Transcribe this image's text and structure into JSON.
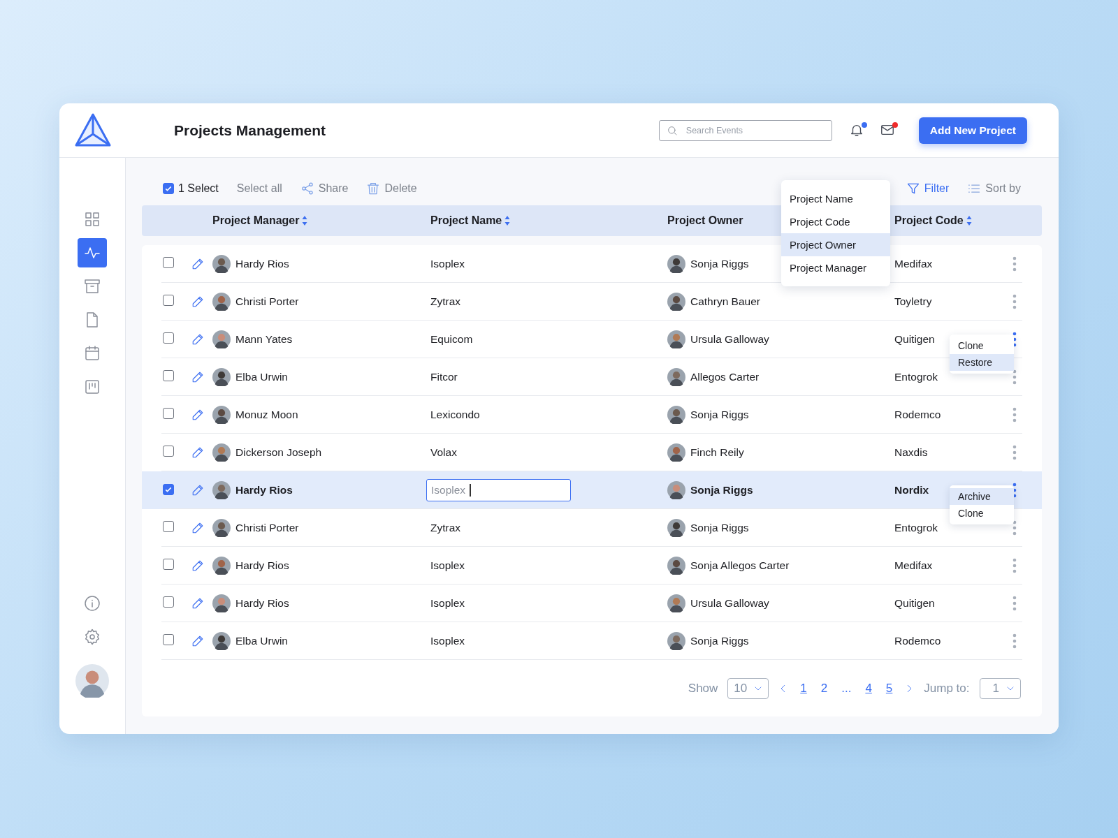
{
  "header": {
    "title": "Projects Management",
    "search": {
      "placeholder": "Search Events"
    },
    "notifications": {
      "unread": true
    },
    "mail": {
      "unread": true
    },
    "add_button": "Add New Project"
  },
  "sidebar": {
    "items": [
      {
        "kind": "grid",
        "selected": false
      },
      {
        "kind": "activity",
        "selected": true
      },
      {
        "kind": "archive",
        "selected": false
      },
      {
        "kind": "file",
        "selected": false
      },
      {
        "kind": "calendar",
        "selected": false
      },
      {
        "kind": "board",
        "selected": false
      }
    ],
    "bottom_items": [
      {
        "kind": "info"
      },
      {
        "kind": "settings"
      }
    ]
  },
  "toolbar": {
    "selection": {
      "checked": true,
      "label": "1 Select"
    },
    "select_all": "Select all",
    "share": "Share",
    "delete": "Delete",
    "filter": "Filter",
    "sort": "Sort by"
  },
  "sort_menu": {
    "items": [
      {
        "label": "Project Name",
        "selected": false
      },
      {
        "label": "Project Code",
        "selected": false
      },
      {
        "label": "Project Owner",
        "selected": true
      },
      {
        "label": "Project Manager",
        "selected": false
      }
    ]
  },
  "table": {
    "columns": [
      {
        "label": "Project Manager",
        "sortable": true
      },
      {
        "label": "Project Name",
        "sortable": true
      },
      {
        "label": "Project Owner",
        "sortable": false
      },
      {
        "label": "Project Code",
        "sortable": true
      }
    ],
    "rows": [
      {
        "checked": false,
        "manager": "Hardy Rios",
        "name": "Isoplex",
        "owner": "Sonja Riggs",
        "code": "Medifax",
        "actions_open": false
      },
      {
        "checked": false,
        "manager": "Christi Porter",
        "name": "Zytrax",
        "owner": "Cathryn Bauer",
        "code": "Toyletry",
        "actions_open": false
      },
      {
        "checked": false,
        "manager": "Mann Yates",
        "name": "Equicom",
        "owner": "Ursula Galloway",
        "code": "Quitigen",
        "actions_open": true,
        "menu": [
          {
            "label": "Clone",
            "selected": false
          },
          {
            "label": "Restore",
            "selected": true
          }
        ]
      },
      {
        "checked": false,
        "manager": "Elba Urwin",
        "name": "Fitcor",
        "owner": "Allegos Carter",
        "code": "Entogrok",
        "actions_open": false
      },
      {
        "checked": false,
        "manager": "Monuz Moon",
        "name": "Lexicondo",
        "owner": "Sonja Riggs",
        "code": "Rodemco",
        "actions_open": false
      },
      {
        "checked": false,
        "manager": "Dickerson Joseph",
        "name": "Volax",
        "owner": "Finch Reily",
        "code": "Naxdis",
        "actions_open": false
      },
      {
        "checked": true,
        "manager": "Hardy Rios",
        "name": "Isoplex",
        "editing": true,
        "owner": "Sonja Riggs",
        "code": "Nordix",
        "actions_open": true,
        "menu": [
          {
            "label": "Archive",
            "selected": true
          },
          {
            "label": "Clone",
            "selected": false
          }
        ]
      },
      {
        "checked": false,
        "manager": "Christi Porter",
        "name": "Zytrax",
        "owner": "Sonja Riggs",
        "code": "Entogrok",
        "actions_open": false
      },
      {
        "checked": false,
        "manager": "Hardy Rios",
        "name": "Isoplex",
        "owner": "Sonja Allegos Carter",
        "code": "Medifax",
        "actions_open": false
      },
      {
        "checked": false,
        "manager": "Hardy Rios",
        "name": "Isoplex",
        "owner": "Ursula Galloway",
        "code": "Quitigen",
        "actions_open": false
      },
      {
        "checked": false,
        "manager": "Elba Urwin",
        "name": "Isoplex",
        "owner": "Sonja Riggs",
        "code": "Rodemco",
        "actions_open": false
      }
    ]
  },
  "pagination": {
    "show_label": "Show",
    "page_size": "10",
    "pages": [
      {
        "label": "1",
        "underlined": true
      },
      {
        "label": "2",
        "underlined": false
      },
      {
        "label": "...",
        "underlined": false
      },
      {
        "label": "4",
        "underlined": true
      },
      {
        "label": "5",
        "underlined": true
      }
    ],
    "jump_label": "Jump to:",
    "jump_value": "1"
  }
}
